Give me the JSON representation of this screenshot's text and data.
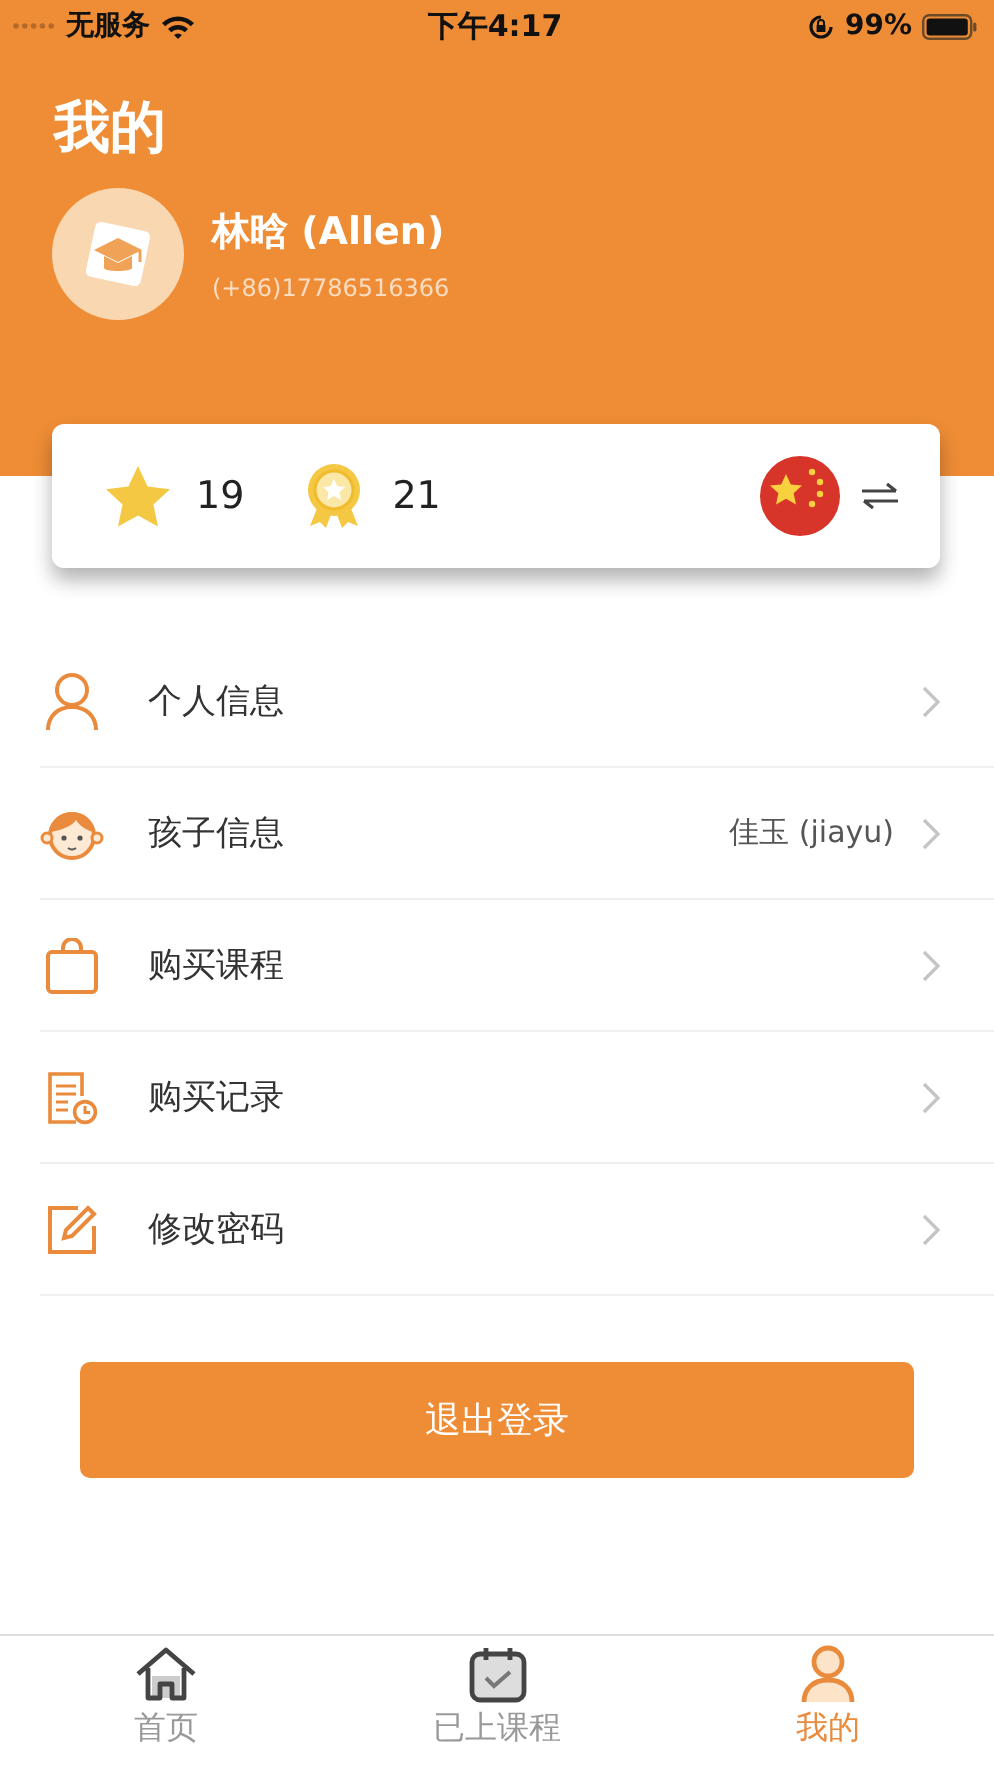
{
  "status_bar": {
    "carrier": "无服务",
    "time": "下午4:17",
    "battery": "99%"
  },
  "title": "我的",
  "profile": {
    "name": "林晗 (Allen)",
    "phone": "(+86)17786516366"
  },
  "stats": [
    {
      "kind": "star",
      "value": "19"
    },
    {
      "kind": "medal",
      "value": "21"
    }
  ],
  "menu": [
    {
      "kind": "person",
      "label": "个人信息"
    },
    {
      "kind": "child",
      "label": "孩子信息",
      "value": "佳玉 (jiayu)"
    },
    {
      "kind": "bag",
      "label": "购买课程"
    },
    {
      "kind": "record",
      "label": "购买记录"
    },
    {
      "kind": "edit",
      "label": "修改密码"
    }
  ],
  "logout": "退出登录",
  "tabs": [
    {
      "kind": "home",
      "label": "首页",
      "selected": false
    },
    {
      "kind": "calendar",
      "label": "已上课程",
      "selected": false
    },
    {
      "kind": "person",
      "label": "我的",
      "selected": true
    }
  ]
}
